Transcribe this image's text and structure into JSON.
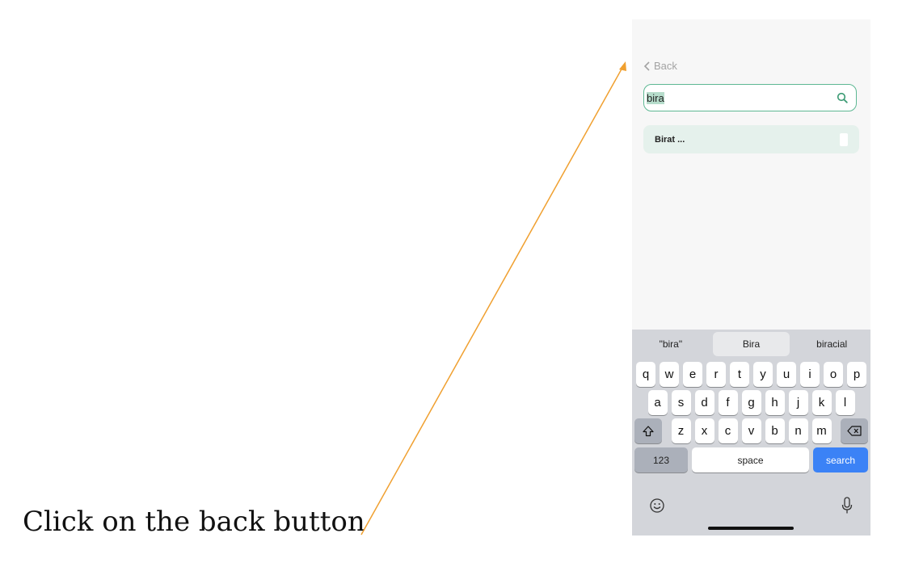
{
  "instruction": "Click on the back button",
  "nav": {
    "back_label": "Back"
  },
  "search": {
    "value": "bira"
  },
  "results": [
    {
      "label": "Birat ..."
    }
  ],
  "keyboard": {
    "suggestions": [
      "\"bira\"",
      "Bira",
      "biracial"
    ],
    "row1": [
      "q",
      "w",
      "e",
      "r",
      "t",
      "y",
      "u",
      "i",
      "o",
      "p"
    ],
    "row2": [
      "a",
      "s",
      "d",
      "f",
      "g",
      "h",
      "j",
      "k",
      "l"
    ],
    "row3": [
      "z",
      "x",
      "c",
      "v",
      "b",
      "n",
      "m"
    ],
    "numbers_label": "123",
    "space_label": "space",
    "search_label": "search"
  },
  "colors": {
    "accent": "#5db893",
    "arrow": "#f0a030",
    "search_key": "#3b82f6"
  }
}
